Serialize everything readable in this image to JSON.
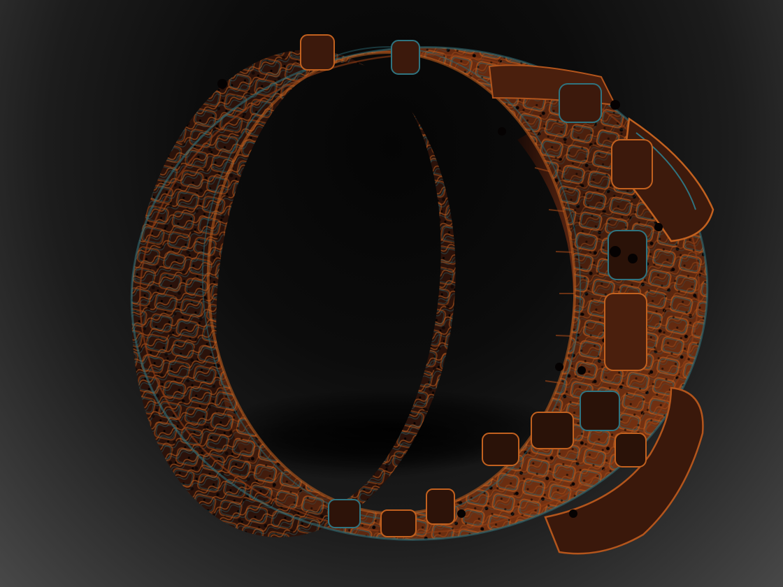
{
  "scene": {
    "subject_icon": "sculpted-ring-icon",
    "background_color": "#1a1a1a",
    "material_colors": {
      "base": "#3a1a10",
      "highlight": "#c8601e",
      "rim": "#2e6f7a",
      "shadow": "#0a0505"
    }
  }
}
